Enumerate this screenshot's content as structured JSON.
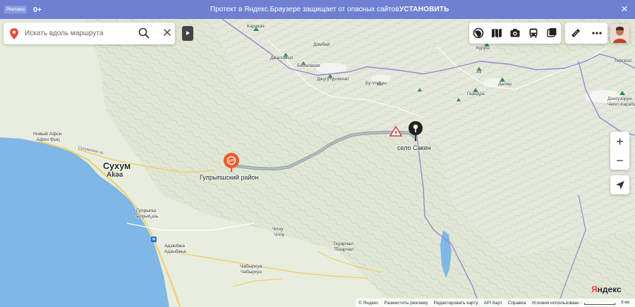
{
  "banner": {
    "ad_tag": "Реклама",
    "age": "0+",
    "text": "Протект в Яндекс.Браузере защищает от опасных сайтов",
    "install_label": "УСТАНОВИТЬ",
    "close_symbol": "×"
  },
  "search": {
    "placeholder": "Искать вдоль маршрута",
    "value": ""
  },
  "toolbar": {
    "icons": [
      "layers-icon",
      "map-icon",
      "panorama-icon",
      "transport-icon",
      "traffic-icon"
    ],
    "ruler_icon": "ruler-icon",
    "more_icon": "more-icon"
  },
  "zoom": {
    "in_label": "+",
    "out_label": "−"
  },
  "map": {
    "labels": {
      "karakaya": "Каракая",
      "dombay": "Домбай",
      "dzhalovchat": "Джаловчат",
      "belalakaya": "Белалакая",
      "dzhuguturlyuchat": "Джугутурлючат",
      "bu_ulgen": "Бу-Ульген",
      "kurush": "Куруш",
      "ak": "Ак",
      "dalar": "Далар",
      "gvandra": "Гвандра",
      "terskol": "Терскол",
      "donguzorun": "Донгузорун",
      "cheget": "Чегет-Карабаши",
      "novy_afon": "Новый Афон",
      "afon_tsyts": "Афон Ҿыц",
      "sukhum": "Сухум",
      "akya": "Аҟәа",
      "sukhumskoe_sh": "Сухумское ш.",
      "gulrypsh_district": "Гулрыпшский район",
      "selo_saken": "село Сакен",
      "gulrypsh": "Гулрыпш",
      "gulrypsh_abkh": "Гылрыҧшь",
      "adzyubzha": "Адзюбжа",
      "adzyubzha_abkh": "Адзыбжьа",
      "chlou": "Члоу",
      "chlou_abkh": "Члоу",
      "tkuarchal": "Ткуарчал",
      "tkuarchal_abkh": "Тҟәарчал",
      "chabyrkha": "Чабырхуа",
      "chabyrkha_abkh": "Чабырхуа"
    }
  },
  "footer": {
    "links": [
      "© Яндекс",
      "Разместить рекламу",
      "Редактировать карту",
      "API Карт",
      "Справка",
      "Условия использования"
    ],
    "scale": "8 км"
  },
  "logo": {
    "first": "Я",
    "rest": "ндекс"
  },
  "colors": {
    "banner": "#6f80d3",
    "sea": "#7fb7e6",
    "land": "#e7eddf",
    "route": "#9aa4a8",
    "border": "#9b86d4",
    "road": "#f3cf6f",
    "pin_red": "#f05a28",
    "pin_black": "#222222"
  }
}
